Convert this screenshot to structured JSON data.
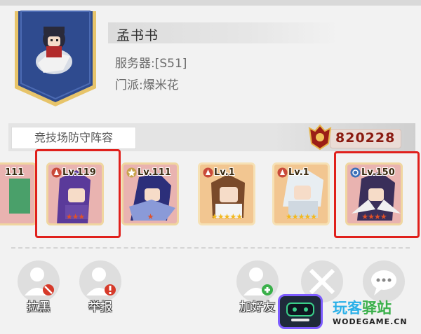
{
  "profile": {
    "name": "孟书书",
    "server": "服务器:[S51]",
    "faction": "门派:爆米花"
  },
  "defense": {
    "label": "竞技场防守阵容",
    "power": "820228",
    "heroes": [
      {
        "level": "111",
        "stars": 0,
        "frame": "red",
        "highlighted": false,
        "badge": "none"
      },
      {
        "level": "Lv.119",
        "stars": 3,
        "frame": "red",
        "highlighted": true,
        "badge": "fire-icon"
      },
      {
        "level": "Lv.111",
        "stars": 1,
        "frame": "red",
        "highlighted": false,
        "badge": "star-badge-icon"
      },
      {
        "level": "Lv.1",
        "stars": 5,
        "frame": "orange",
        "highlighted": false,
        "badge": "fire-icon"
      },
      {
        "level": "Lv.1",
        "stars": 5,
        "frame": "orange",
        "highlighted": false,
        "badge": "fire-icon"
      },
      {
        "level": "Lv.150",
        "stars": 4,
        "frame": "red",
        "highlighted": true,
        "badge": "water-icon"
      }
    ]
  },
  "actions": {
    "block": "拉黑",
    "report": "举报",
    "add_friend": "加好友"
  },
  "watermark": {
    "title_a": "玩客",
    "title_b": "驿站",
    "domain": "WODEGAME.CN"
  },
  "colors": {
    "power": "#8a1a10",
    "highlight": "#e0201c",
    "banner": "#2f4b8f"
  }
}
